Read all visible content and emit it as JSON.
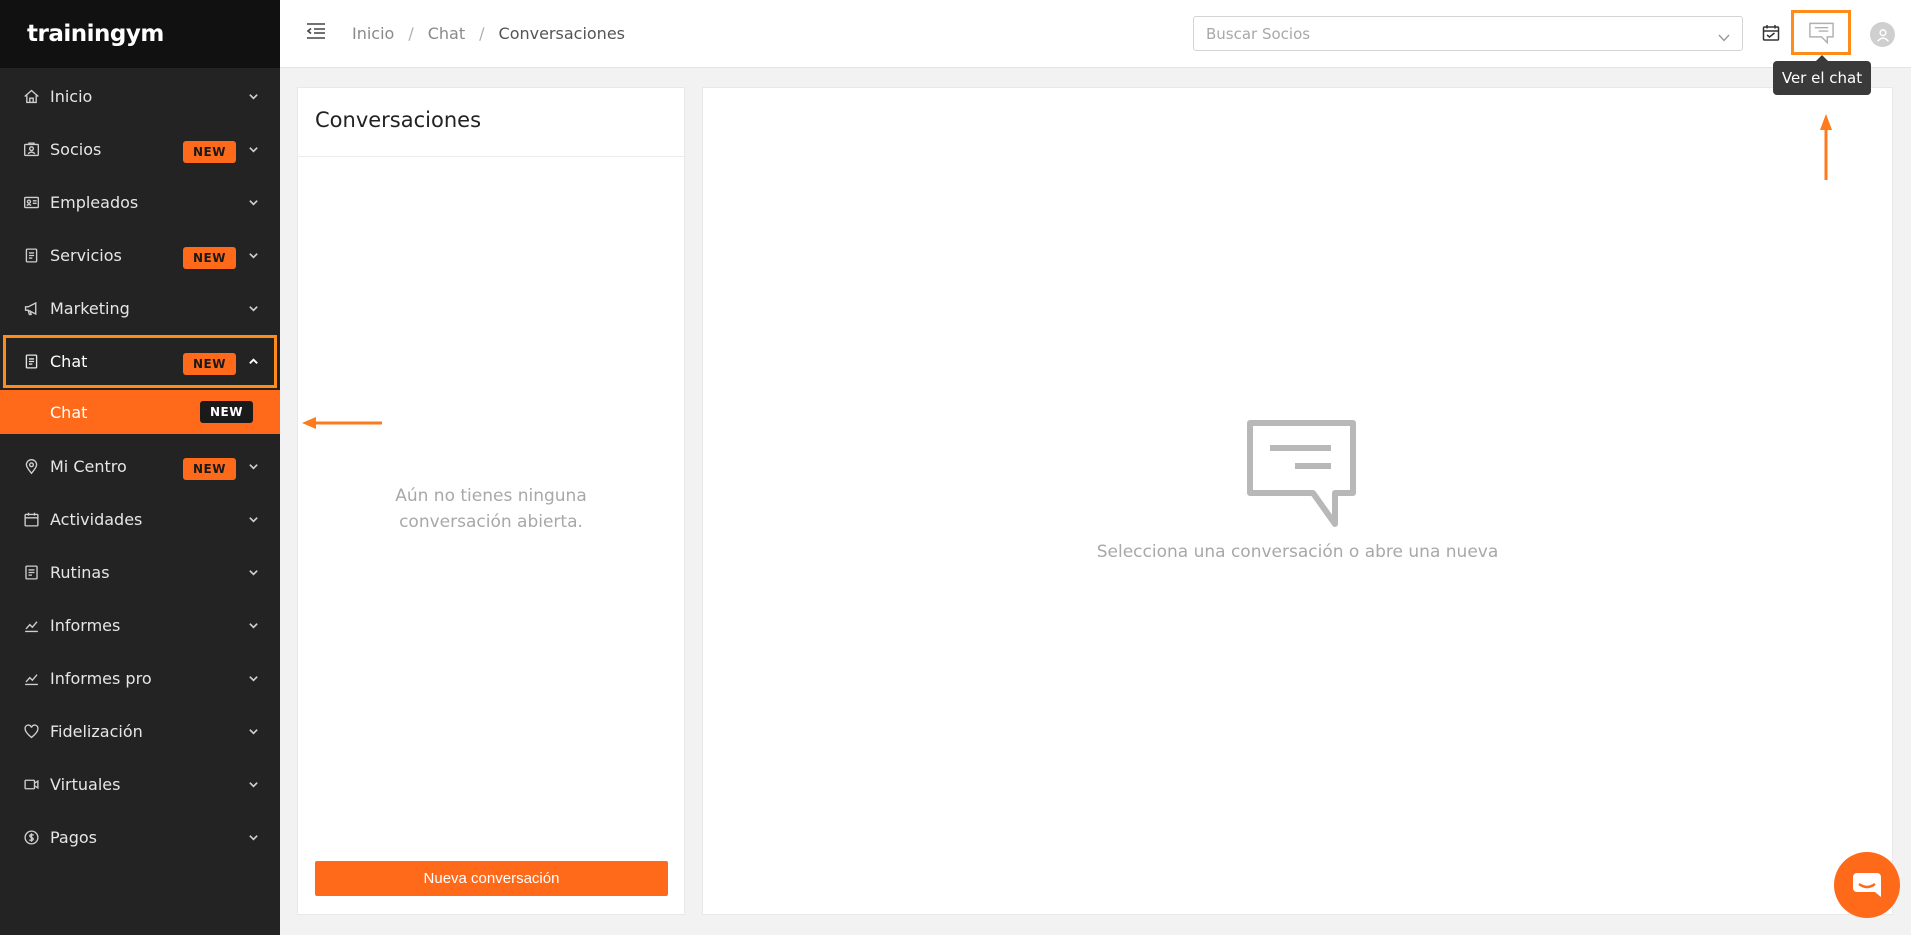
{
  "brand": {
    "logo_text": "trainingym"
  },
  "sidebar": {
    "items": [
      {
        "label": "Inicio",
        "icon": "home-icon"
      },
      {
        "label": "Socios",
        "icon": "id-card-icon",
        "badge": "NEW"
      },
      {
        "label": "Empleados",
        "icon": "vcard-icon"
      },
      {
        "label": "Servicios",
        "icon": "document-icon",
        "badge": "NEW"
      },
      {
        "label": "Marketing",
        "icon": "megaphone-icon"
      },
      {
        "label": "Chat",
        "icon": "chat-document-icon",
        "badge": "NEW"
      },
      {
        "label": "Mi Centro",
        "icon": "location-pin-icon",
        "badge": "NEW"
      },
      {
        "label": "Actividades",
        "icon": "calendar-icon"
      },
      {
        "label": "Rutinas",
        "icon": "clipboard-icon"
      },
      {
        "label": "Informes",
        "icon": "chart-line-icon"
      },
      {
        "label": "Informes pro",
        "icon": "chart-line-icon"
      },
      {
        "label": "Fidelización",
        "icon": "heart-icon"
      },
      {
        "label": "Virtuales",
        "icon": "video-camera-icon"
      },
      {
        "label": "Pagos",
        "icon": "dollar-coin-icon"
      }
    ],
    "subitem": {
      "label": "Chat",
      "badge": "NEW"
    }
  },
  "header": {
    "breadcrumb": [
      "Inicio",
      "Chat",
      "Conversaciones"
    ],
    "breadcrumb_sep": "/",
    "search_placeholder": "Buscar Socios",
    "tooltip": "Ver el chat"
  },
  "conversations": {
    "title": "Conversaciones",
    "empty_text": "Aún no tienes ninguna conversación abierta.",
    "new_button": "Nueva conversación"
  },
  "main": {
    "empty_text": "Selecciona una conversación o abre una nueva"
  },
  "colors": {
    "accent": "#ff6a1a",
    "highlight": "#ff8c1a",
    "sidebar_bg": "#232323"
  }
}
